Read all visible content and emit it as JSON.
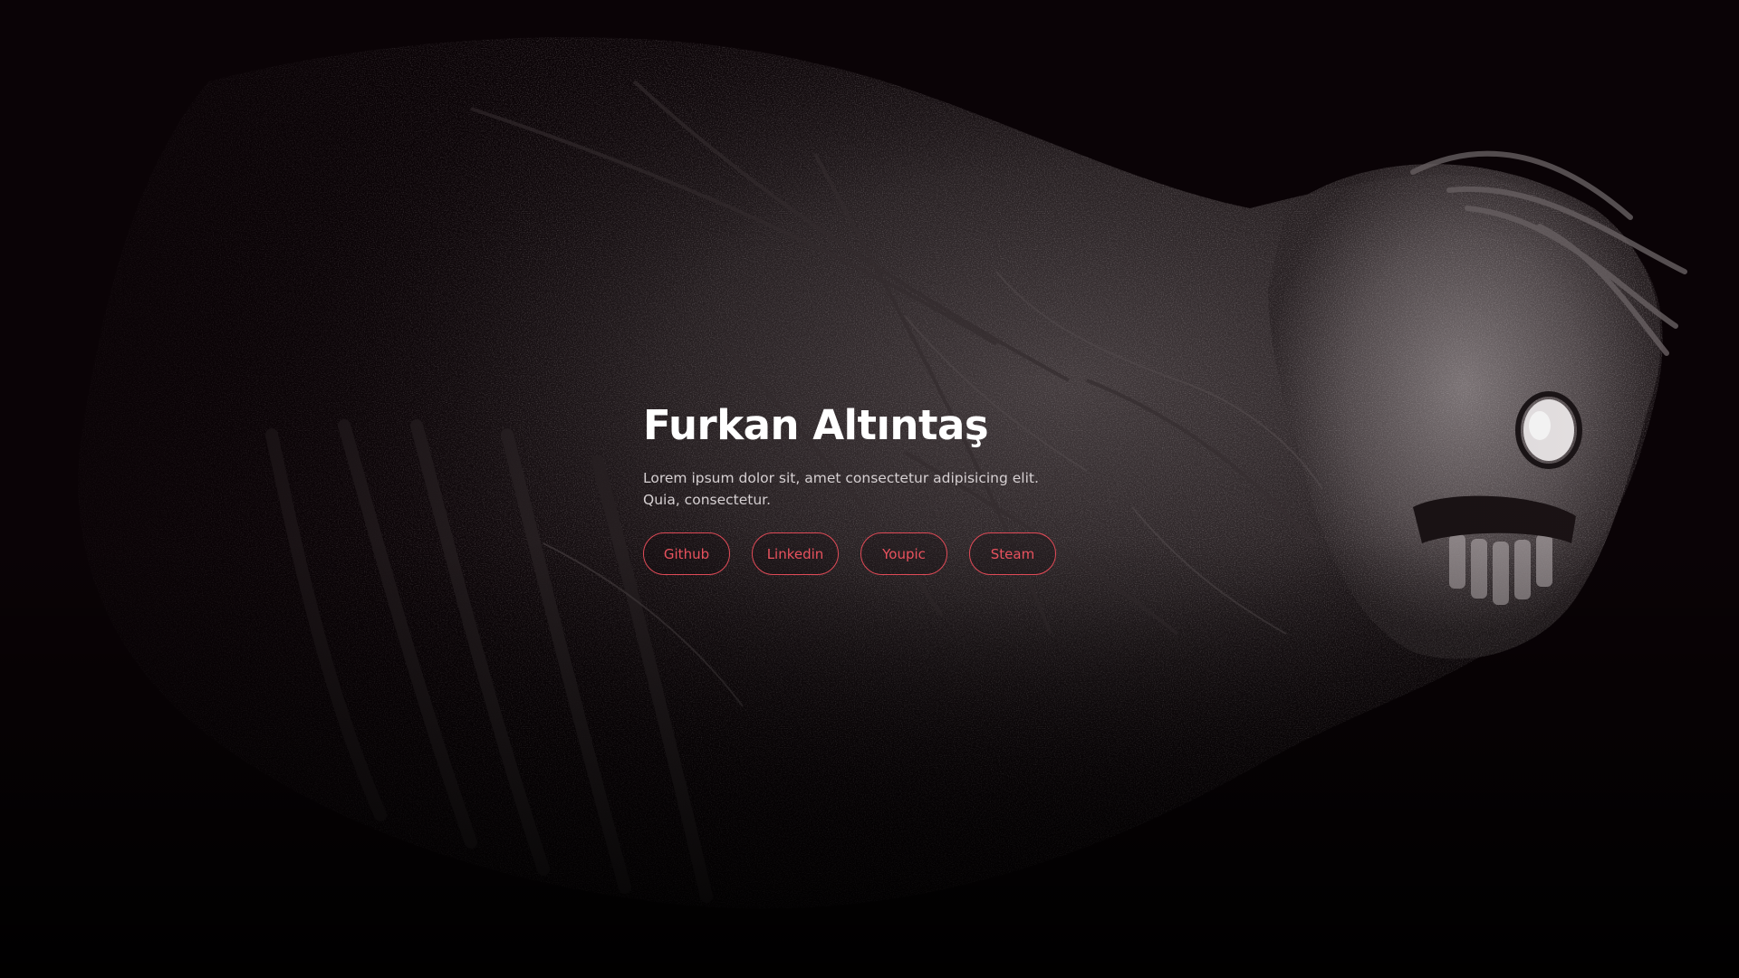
{
  "hero": {
    "title": "Furkan Altıntaş",
    "description": "Lorem ipsum dolor sit, amet consectetur adipisicing elit. Quia, consectetur."
  },
  "links": [
    {
      "label": "Github"
    },
    {
      "label": "Linkedin"
    },
    {
      "label": "Youpic"
    },
    {
      "label": "Steam"
    }
  ],
  "colors": {
    "background": "#0a0306",
    "accent": "#e04a57",
    "title": "#ffffff",
    "text": "#d6d0d2"
  }
}
